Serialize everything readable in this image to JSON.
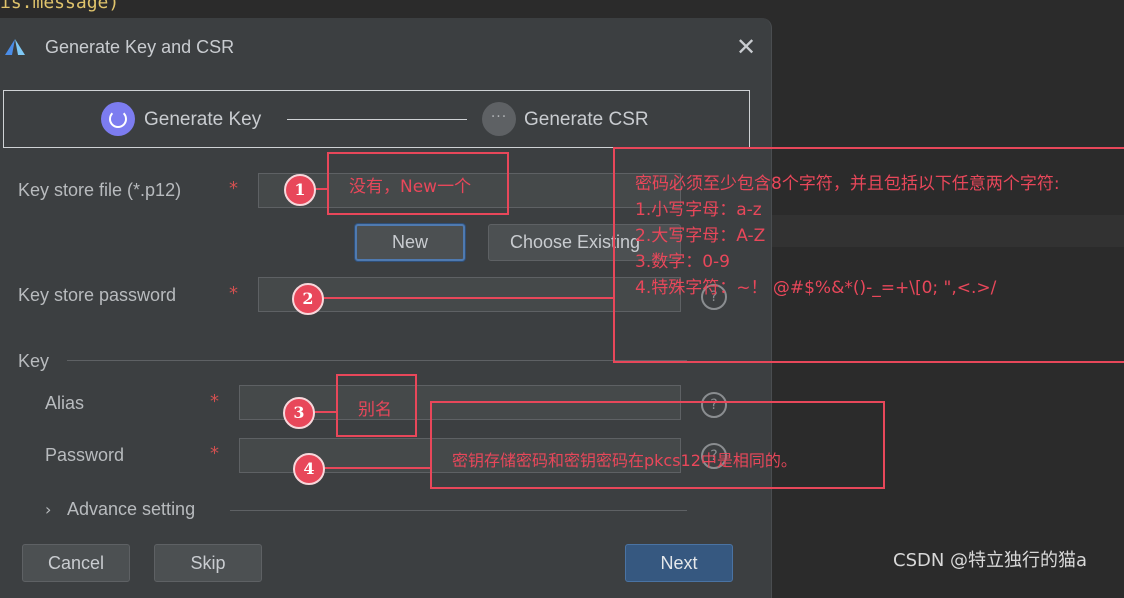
{
  "background": {
    "code_fragment": "is.message)"
  },
  "dialog": {
    "title": "Generate Key and CSR",
    "close_icon": "close-icon",
    "steps": [
      {
        "label": "Generate Key",
        "state": "active"
      },
      {
        "label": "Generate CSR",
        "state": "pending"
      }
    ],
    "key_store_file_label": "Key store file (*.p12)",
    "key_store_file_value": "",
    "new_button": "New",
    "choose_existing_button": "Choose Existing",
    "key_store_password_label": "Key store password",
    "key_section_label": "Key",
    "alias_label": "Alias",
    "password_label": "Password",
    "advance_setting_label": "Advance setting",
    "required_mark": "*",
    "help_glyph": "?",
    "cancel_button": "Cancel",
    "skip_button": "Skip",
    "next_button": "Next"
  },
  "annotations": {
    "callout1": {
      "number": "1",
      "text": "没有，New一个"
    },
    "callout2": {
      "number": "2",
      "lines": [
        "密码必须至少包含8个字符，并且包括以下任意两个字符:",
        "1.小写字母：a-z",
        "2.大写字母：A-Z",
        "3.数字：0-9",
        "4.特殊字符：~！ @#$%&*()-_=+\\[0; \",<.>/"
      ]
    },
    "callout3": {
      "number": "3",
      "text": "别名"
    },
    "callout4": {
      "number": "4",
      "text": "密钥存储密码和密钥密码在pkcs12中是相同的。"
    },
    "color": "#e8475a"
  },
  "watermark": "CSDN @特立独行的猫a",
  "colors": {
    "dialog_bg": "#3c3f41",
    "accent_blue": "#365880",
    "step_active": "#7c7cf0"
  }
}
